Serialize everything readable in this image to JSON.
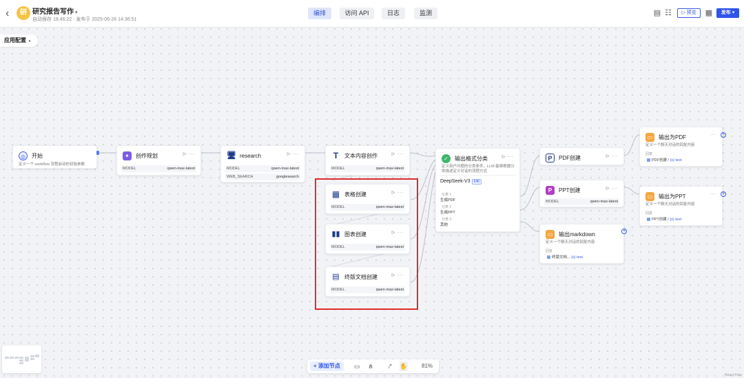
{
  "header": {
    "back_icon": "chevron-left-icon",
    "avatar_text": "研",
    "app_title": "研究报告写作",
    "subtitle": "自动保存 18:46:22 · 发布于 2025-06-26 14:36:51",
    "tabs": [
      "编排",
      "访问 API",
      "日志",
      "监测"
    ],
    "active_tab": "编排",
    "preview_label": "预览",
    "publish_label": "发布",
    "accent_color": "#2f54eb"
  },
  "config_pill": {
    "label": "应用配置"
  },
  "nodes": {
    "start": {
      "title": "开始",
      "desc": "定义一个 workflow 流程启动的初始参数"
    },
    "plan": {
      "title": "创作规划",
      "model_key": "MODEL",
      "model_val": "qwen-max-latest"
    },
    "research": {
      "title": "research",
      "model_key": "MODEL",
      "model_val": "qwen-max-latest",
      "search_key": "WEB_SEARCH",
      "search_val": "googlesearch"
    },
    "text": {
      "title": "文本内容创作",
      "model_key": "MODEL",
      "model_val": "qwen-max-latest"
    },
    "table": {
      "title": "表格创建",
      "model_key": "MODEL",
      "model_val": "qwen-max-latest"
    },
    "chart": {
      "title": "图表创建",
      "model_key": "MODEL",
      "model_val": "qwen-max-latest"
    },
    "final": {
      "title": "终版文档创建",
      "model_key": "MODEL",
      "model_val": "qwen-max-latest"
    },
    "classify": {
      "title": "输出格式分类",
      "desc1": "定义用户问题的分类条件，LLM 能够根据分",
      "desc2": "类描述定义对话的流程方式",
      "model": "DeepSeek-V3",
      "badge": "64K",
      "c1_label": "分类 1",
      "c1_val": "生成PDF",
      "c2_label": "分类 2",
      "c2_val": "生成PPT",
      "c3_label": "分类 3",
      "c3_val": "其他"
    },
    "pdf": {
      "title": "PDF创建"
    },
    "ppt": {
      "title": "PPT创建",
      "model_key": "MODEL",
      "model_val": "qwen-max-latest"
    },
    "md": {
      "title": "输出markdown",
      "desc": "定义一个聊天对话的回复内容",
      "sec": "回复",
      "tag": "终版文档...",
      "var": "{x} text"
    },
    "out_pdf": {
      "title": "输出为PDF",
      "desc": "定义一个聊天对话的回复内容",
      "sec": "回复",
      "tag": "PDF创建 /",
      "var": "{x} text"
    },
    "out_ppt": {
      "title": "输出为PPT",
      "desc": "定义一个聊天对话的回复内容",
      "sec": "回复",
      "tag": "PPT创建 /",
      "var": "{x} text"
    }
  },
  "node_controls": "▷ ···",
  "bottombar": {
    "add_node": "添加节点",
    "zoom": "81%"
  },
  "attribution": "React Flow"
}
